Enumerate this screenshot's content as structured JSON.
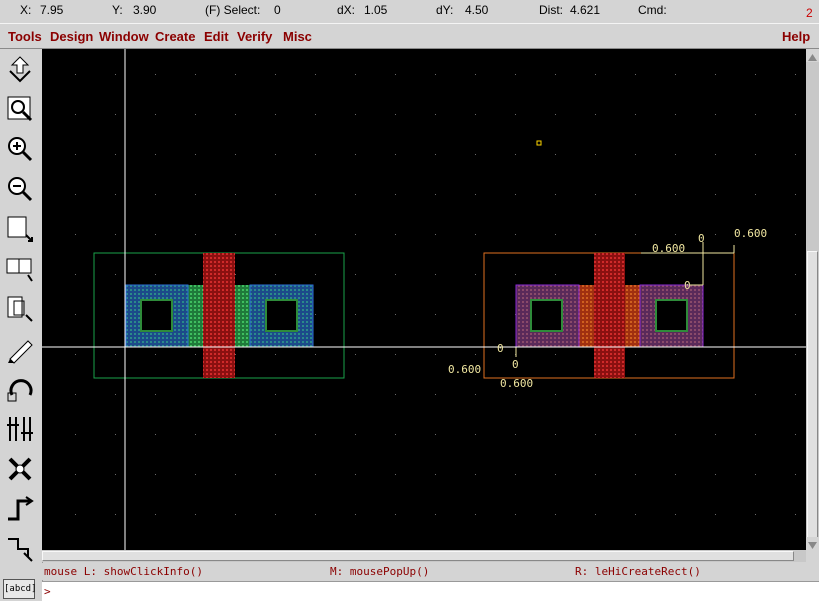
{
  "status": {
    "x_label": "X:",
    "x_value": "7.95",
    "y_label": "Y:",
    "y_value": "3.90",
    "select_label": "(F) Select:",
    "select_value": "0",
    "dx_label": "dX:",
    "dx_value": "1.05",
    "dy_label": "dY:",
    "dy_value": "4.50",
    "dist_label": "Dist:",
    "dist_value": "4.621",
    "cmd_label": "Cmd:",
    "cmd_value": "",
    "window_number": "2"
  },
  "menu": {
    "tools": "Tools",
    "design": "Design",
    "window": "Window",
    "create": "Create",
    "edit": "Edit",
    "verify": "Verify",
    "misc": "Misc",
    "help": "Help"
  },
  "toolbar_icons": [
    "save-icon",
    "fit-view-icon",
    "zoom-in-icon",
    "zoom-out-icon",
    "stretch-icon",
    "copy-icon",
    "move-icon",
    "edit-properties-icon",
    "undo-icon",
    "redo-icon",
    "create-instance-icon",
    "create-path-icon",
    "create-polygon-icon"
  ],
  "ruler_labels": {
    "top_zero": "0",
    "top_right": "0.600",
    "top_mid": "0.600",
    "right_zero": "0",
    "left_zero": "0",
    "left_value": "0.600",
    "bottom_zero": "0",
    "bottom_value": "0.600"
  },
  "mouse": {
    "left": "mouse L: showClickInfo()",
    "middle": "M: mousePopUp()",
    "right": "R: leHiCreateRect()"
  },
  "cmd_prompt": ">",
  "abcd_label": "[abcd]",
  "colors": {
    "accent": "#8b0000",
    "canvas": "#000000",
    "diffusion": "#2b6fd6",
    "poly": "#c02020",
    "metal": "#2e8b3a",
    "highlight_box": "#e07020",
    "cell_box": "#1aa24a",
    "ruler": "#f0e6a0"
  }
}
